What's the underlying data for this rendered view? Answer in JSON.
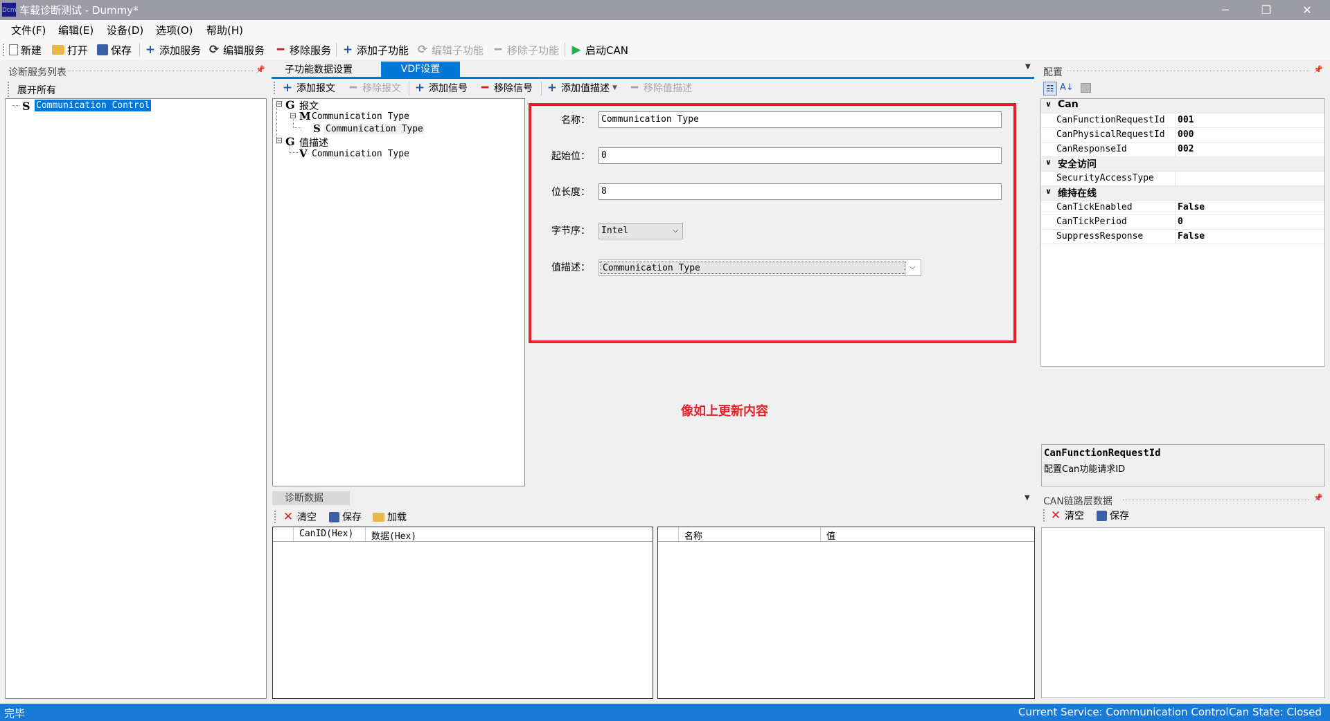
{
  "window": {
    "title": "车载诊断测试 - Dummy*",
    "icon": "app-icon",
    "controls": {
      "minimize": "─",
      "maximize": "❐",
      "close": "✕"
    }
  },
  "menu": [
    "文件(F)",
    "编辑(E)",
    "设备(D)",
    "选项(O)",
    "帮助(H)"
  ],
  "toolbar": {
    "new": "新建",
    "open": "打开",
    "save": "保存",
    "add_service": "添加服务",
    "edit_service": "编辑服务",
    "remove_service": "移除服务",
    "add_sub": "添加子功能",
    "edit_sub": "编辑子功能",
    "remove_sub": "移除子功能",
    "start_can": "启动CAN"
  },
  "left": {
    "title": "诊断服务列表",
    "expand_all": "展开所有",
    "items": [
      {
        "glyph": "S",
        "label": "Communication Control"
      }
    ]
  },
  "tabs": [
    "子功能数据设置",
    "VDF设置"
  ],
  "vdf_toolbar": {
    "add_msg": "添加报文",
    "remove_msg": "移除报文",
    "add_signal": "添加信号",
    "remove_signal": "移除信号",
    "add_valdesc": "添加值描述",
    "remove_valdesc": "移除值描述"
  },
  "vdf_tree": [
    {
      "toggle": "⊟",
      "glyph": "G",
      "label": "报文"
    },
    {
      "toggle": "⊟",
      "glyph": "M",
      "label": "Communication Type"
    },
    {
      "toggle": "",
      "glyph": "S",
      "label": "Communication Type"
    },
    {
      "toggle": "⊟",
      "glyph": "G",
      "label": "值描述"
    },
    {
      "toggle": "",
      "glyph": "V",
      "label": "Communication Type"
    }
  ],
  "form": {
    "name_label": "名称：",
    "name_value": "Communication Type",
    "start_label": "起始位：",
    "start_value": "0",
    "length_label": "位长度：",
    "length_value": "8",
    "order_label": "字节序：",
    "order_value": "Intel",
    "valdesc_label": "值描述：",
    "valdesc_value": "Communication Type"
  },
  "annotation": "像如上更新内容",
  "config": {
    "title": "配置",
    "groups": [
      {
        "name": "Can",
        "rows": [
          {
            "k": "CanFunctionRequestId",
            "v": "001"
          },
          {
            "k": "CanPhysicalRequestId",
            "v": "000"
          },
          {
            "k": "CanResponseId",
            "v": "002"
          }
        ]
      },
      {
        "name": "安全访问",
        "rows": [
          {
            "k": "SecurityAccessType",
            "v": ""
          }
        ]
      },
      {
        "name": "维持在线",
        "rows": [
          {
            "k": "CanTickEnabled",
            "v": "False"
          },
          {
            "k": "CanTickPeriod",
            "v": "0"
          },
          {
            "k": "SuppressResponse",
            "v": "False"
          }
        ]
      }
    ],
    "desc_title": "CanFunctionRequestId",
    "desc_text": "配置Can功能请求ID"
  },
  "diag": {
    "title": "诊断数据",
    "clear": "清空",
    "save": "保存",
    "load": "加载",
    "col1": "CanID(Hex)",
    "col2": "数据(Hex)",
    "col3": "名称",
    "col4": "值"
  },
  "can": {
    "title": "CAN链路层数据",
    "clear": "清空",
    "save": "保存"
  },
  "status": {
    "left": "完毕",
    "service": "Current Service: Communication Control",
    "can_state": "Can State: Closed"
  },
  "colors": {
    "accent": "#1a7ad8",
    "highlight": "#0078d7",
    "annotation_red": "#e8202a",
    "add_blue": "#1e5ab4",
    "remove_red": "#d42020",
    "start_green": "#22b04c"
  }
}
